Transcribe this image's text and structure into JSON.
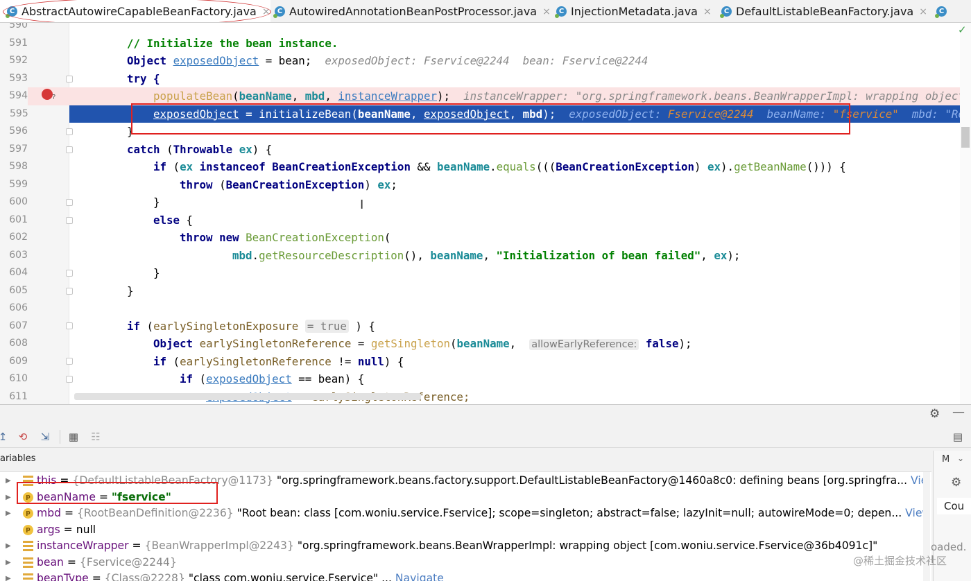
{
  "tabs": [
    {
      "label": "AbstractAutowireCapableBeanFactory.java",
      "active": true,
      "close": "×"
    },
    {
      "label": "AutowiredAnnotationBeanPostProcessor.java",
      "active": false,
      "close": "×"
    },
    {
      "label": "InjectionMetadata.java",
      "active": false,
      "close": "×"
    },
    {
      "label": "DefaultListableBeanFactory.java",
      "active": false,
      "close": "×"
    }
  ],
  "tab_icon_letter": "C",
  "editor": {
    "line_numbers": [
      "590",
      "591",
      "592",
      "593",
      "594",
      "595",
      "596",
      "597",
      "598",
      "599",
      "600",
      "601",
      "602",
      "603",
      "604",
      "605",
      "606",
      "607",
      "608",
      "609",
      "610",
      "611"
    ],
    "comment": "// Initialize the bean instance.",
    "l592": {
      "type": "Object",
      "var": "exposedObject",
      "rest": " = bean;",
      "debug": "exposedObject: Fservice@2244  bean: Fservice@2244"
    },
    "l593": "try {",
    "l594": {
      "method": "populateBean",
      "args_a": "beanName",
      "args_b": "mbd",
      "args_c": "instanceWrapper",
      "tail": ");",
      "debug": "instanceWrapper: \"org.springframework.beans.BeanWrapperImpl: wrapping object ["
    },
    "l595": {
      "var": "exposedObject",
      "mid": " = initializeBean(",
      "a": "beanName",
      "b": "exposedObject",
      "c": "mbd",
      "tail": ");",
      "debug1": "exposedObject: ",
      "debug1v": "Fservice@2244",
      "debug2": "  beanName: ",
      "debug2v": "\"fservice\"",
      "debug3": "  mbd: \"Roo"
    },
    "l596": "}",
    "l597": {
      "kw": "catch",
      "type": "Throwable",
      "var": "ex",
      "rest": ") {"
    },
    "l598": {
      "kw": "if",
      "ex": "ex",
      "inst": "instanceof",
      "cls": "BeanCreationException",
      "and": " && ",
      "bn": "beanName",
      "eq": "equals",
      "cast": "BeanCreationException",
      "ex2": "ex",
      "gbn": "getBeanName",
      "tail": "())) {"
    },
    "l599": {
      "kw": "throw",
      "cls": "BeanCreationException",
      "ex": "ex"
    },
    "l600": "}",
    "l601": {
      "kw": "else",
      "rest": " {"
    },
    "l602": {
      "kw1": "throw",
      "kw2": "new",
      "cls": "BeanCreationException"
    },
    "l603": {
      "mbd": "mbd",
      "m": "getResourceDescription",
      "bn": "beanName",
      "str": "\"Initialization of bean failed\"",
      "ex": "ex"
    },
    "l604": "}",
    "l605": "}",
    "l607": {
      "kw": "if",
      "var": "earlySingletonExposure",
      "hint": "= true",
      "rest": " ) {"
    },
    "l608": {
      "type": "Object",
      "var": "earlySingletonReference",
      "m": "getSingleton",
      "bn": "beanName",
      "hint": "allowEarlyReference:",
      "val": "false"
    },
    "l609": {
      "kw": "if",
      "var": "earlySingletonReference",
      "op": " != ",
      "nul": "null"
    },
    "l610": {
      "kw": "if",
      "var": "exposedObject",
      "rest": " == bean) {"
    },
    "l611": {
      "var": "exposedObject",
      "rest": " = earlySingletonReference;"
    }
  },
  "debug_panel": {
    "title": "ariables",
    "right_col": "M",
    "right_label": "Cou",
    "loaded": "oaded. I",
    "watermark": "@稀土掘金技术社区",
    "variables": [
      {
        "icon": "field",
        "name": "this",
        "ref": "{DefaultListableBeanFactory@1173}",
        "value": "\"org.springframework.beans.factory.support.DefaultListableBeanFactory@1460a8c0: defining beans [org.springfra...",
        "link": "View"
      },
      {
        "icon": "param",
        "name": "beanName",
        "ref": "",
        "value": "\"fservice\"",
        "link": ""
      },
      {
        "icon": "param",
        "name": "mbd",
        "ref": "{RootBeanDefinition@2236}",
        "value": "\"Root bean: class [com.woniu.service.Fservice]; scope=singleton; abstract=false; lazyInit=null; autowireMode=0; depen...",
        "link": "View"
      },
      {
        "icon": "param",
        "name": "args",
        "ref": "",
        "value": "null",
        "link": ""
      },
      {
        "icon": "field",
        "name": "instanceWrapper",
        "ref": "{BeanWrapperImpl@2243}",
        "value": "\"org.springframework.beans.BeanWrapperImpl: wrapping object [com.woniu.service.Fservice@36b4091c]\"",
        "link": ""
      },
      {
        "icon": "field",
        "name": "bean",
        "ref": "{Fservice@2244}",
        "value": "",
        "link": ""
      },
      {
        "icon": "field",
        "name": "beanType",
        "ref": "{Class@2228}",
        "value": "\"class com.woniu.service.Fservice\"",
        "link": "Navigate"
      }
    ]
  },
  "colors": {
    "selection": "#2154ae",
    "highlight_box": "#e0211f",
    "breakpoint": "#d63838"
  }
}
